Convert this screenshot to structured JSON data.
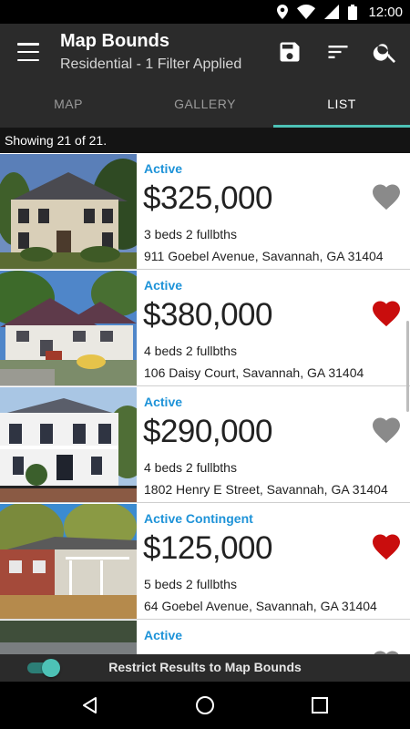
{
  "status_bar": {
    "time": "12:00",
    "icons": [
      "location-icon",
      "wifi-icon",
      "signal-icon",
      "battery-icon"
    ]
  },
  "app_bar": {
    "title": "Map Bounds",
    "subtitle": "Residential - 1 Filter Applied",
    "actions": [
      "save-icon",
      "sort-icon",
      "search-icon"
    ]
  },
  "tabs": [
    {
      "label": "MAP",
      "active": false
    },
    {
      "label": "GALLERY",
      "active": false
    },
    {
      "label": "LIST",
      "active": true
    }
  ],
  "count_text": "Showing 21 of 21.",
  "listings": [
    {
      "status": "Active",
      "price": "$325,000",
      "beds": "3 beds 2 fullbths",
      "address": "911 Goebel Avenue, Savannah, GA 31404",
      "favorite": false
    },
    {
      "status": "Active",
      "price": "$380,000",
      "beds": "4 beds 2 fullbths",
      "address": "106 Daisy Court, Savannah, GA 31404",
      "favorite": true
    },
    {
      "status": "Active",
      "price": "$290,000",
      "beds": "4 beds 2 fullbths",
      "address": "1802 Henry E Street, Savannah, GA 31404",
      "favorite": false
    },
    {
      "status": "Active Contingent",
      "price": "$125,000",
      "beds": "5 beds 2 fullbths",
      "address": "64 Goebel Avenue, Savannah, GA 31404",
      "favorite": true
    },
    {
      "status": "Active",
      "price": "",
      "beds": "",
      "address": "",
      "favorite": false
    }
  ],
  "bottom_bar": {
    "toggle_on": true,
    "label": "Restrict Results to Map Bounds"
  },
  "colors": {
    "accent": "#4dc2b6",
    "status_blue": "#1e93d8",
    "favorite_red": "#c90d0d",
    "unfavorite_gray": "#8a8a8a",
    "app_bar": "#2b2b2b"
  }
}
